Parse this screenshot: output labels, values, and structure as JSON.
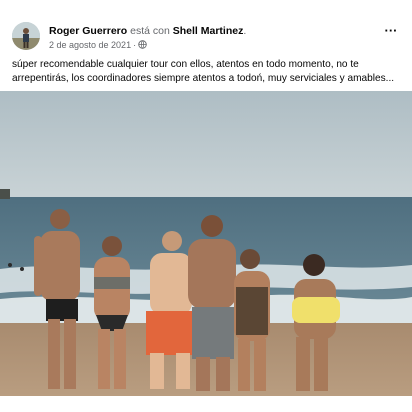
{
  "post": {
    "author": "Roger Guerrero",
    "connector": " está con ",
    "tagged": "Shell Martinez",
    "tagged_suffix": ".",
    "date": "2 de agosto de 2021",
    "separator": "·",
    "audience_icon": "globe-icon",
    "more_icon": "more-options-icon",
    "more_label": "···",
    "caption": "súper recomendable cualquier tour con ellos, atentos en todo momento, no te arrepentirás, los coordinadores siempre atentos a todoń, muy serviciales y amables..."
  },
  "photo": {
    "description_icon": "beach-group-photo",
    "colors": {
      "sky": "#b9c6cc",
      "sea": "#5f7f8f",
      "foam": "#e6ecee",
      "sand": "#b29476"
    }
  }
}
